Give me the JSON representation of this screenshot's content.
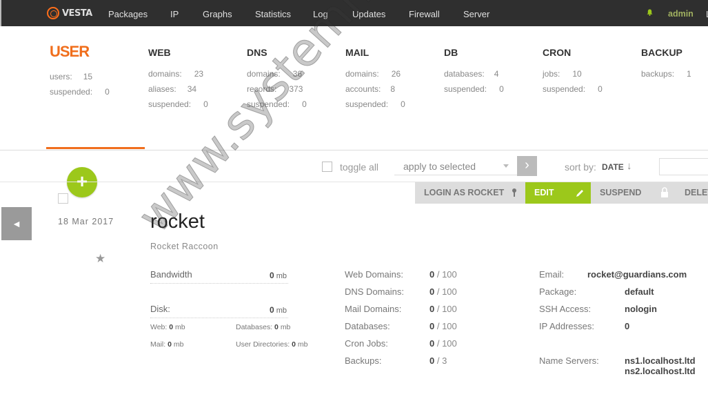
{
  "nav": {
    "logo_text": "VESTA",
    "items": [
      "Packages",
      "IP",
      "Graphs",
      "Statistics",
      "Log",
      "Updates",
      "Firewall",
      "Server"
    ],
    "user": "admin",
    "logout_partial": "L"
  },
  "stats": {
    "user": {
      "title": "USER",
      "rows": [
        {
          "k": "users:",
          "v": "15"
        },
        {
          "k": "suspended:",
          "v": "0"
        }
      ]
    },
    "web": {
      "title": "WEB",
      "rows": [
        {
          "k": "domains:",
          "v": "23"
        },
        {
          "k": "aliases:",
          "v": "34"
        },
        {
          "k": "suspended:",
          "v": "0"
        }
      ]
    },
    "dns": {
      "title": "DNS",
      "rows": [
        {
          "k": "domains:",
          "v": "36"
        },
        {
          "k": "records:",
          "v": "373"
        },
        {
          "k": "suspended:",
          "v": "0"
        }
      ]
    },
    "mail": {
      "title": "MAIL",
      "rows": [
        {
          "k": "domains:",
          "v": "26"
        },
        {
          "k": "accounts:",
          "v": "8"
        },
        {
          "k": "suspended:",
          "v": "0"
        }
      ]
    },
    "db": {
      "title": "DB",
      "rows": [
        {
          "k": "databases:",
          "v": "4"
        },
        {
          "k": "suspended:",
          "v": "0"
        }
      ]
    },
    "cron": {
      "title": "CRON",
      "rows": [
        {
          "k": "jobs:",
          "v": "10"
        },
        {
          "k": "suspended:",
          "v": "0"
        }
      ]
    },
    "backup": {
      "title": "BACKUP",
      "rows": [
        {
          "k": "backups:",
          "v": "1"
        }
      ]
    }
  },
  "toolbar": {
    "add_symbol": "+",
    "toggle_all": "toggle all",
    "apply_placeholder": "apply to selected",
    "apply_go": "›",
    "sort_label": "sort by:",
    "sort_value": "DATE",
    "sort_arrow": "↓"
  },
  "record": {
    "date": "18 Mar 2017",
    "name": "rocket",
    "full_name": "Rocket Raccoon",
    "star": "★",
    "prev_arrow": "◄",
    "actions": {
      "login": "LOGIN AS ROCKET",
      "edit": "EDIT",
      "suspend": "SUSPEND",
      "delete": "DELETE"
    },
    "bandwidth": {
      "label": "Bandwidth",
      "value": "0",
      "unit": "mb"
    },
    "disk": {
      "label": "Disk:",
      "value": "0",
      "unit": "mb"
    },
    "disk_details": {
      "web": {
        "label": "Web:",
        "value": "0",
        "unit": "mb"
      },
      "databases": {
        "label": "Databases:",
        "value": "0",
        "unit": "mb"
      },
      "mail": {
        "label": "Mail:",
        "value": "0",
        "unit": "mb"
      },
      "user_dirs": {
        "label": "User Directories:",
        "value": "0",
        "unit": "mb"
      }
    },
    "limits": [
      {
        "label": "Web Domains:",
        "used": "0",
        "max": " / 100"
      },
      {
        "label": "DNS Domains:",
        "used": "0",
        "max": " / 100"
      },
      {
        "label": "Mail Domains:",
        "used": "0",
        "max": " / 100"
      },
      {
        "label": "Databases:",
        "used": "0",
        "max": " / 100"
      },
      {
        "label": "Cron Jobs:",
        "used": "0",
        "max": " / 100"
      },
      {
        "label": "Backups:",
        "used": "0",
        "max": " / 3"
      }
    ],
    "info": {
      "email_label": "Email:",
      "email": "rocket@guardians.com",
      "package_label": "Package:",
      "package": "default",
      "ssh_label": "SSH Access:",
      "ssh": "nologin",
      "ip_label": "IP Addresses:",
      "ip": "0",
      "ns_label": "Name Servers:",
      "ns1": "ns1.localhost.ltd",
      "ns2": "ns2.localhost.ltd"
    }
  },
  "watermark": "www.systemmen.com"
}
